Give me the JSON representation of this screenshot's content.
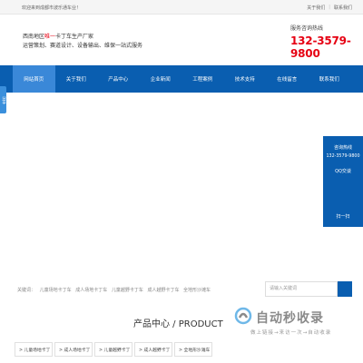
{
  "topbar": {
    "welcome": "欢迎来到成都市波乐通车业！",
    "links": [
      "关于我们",
      "联系我们"
    ],
    "separator": "|"
  },
  "header": {
    "slogan_line1_prefix": "西南地区",
    "slogan_line1_highlight": "唯一",
    "slogan_line1_suffix": "卡丁车生产厂家",
    "slogan_line2": "运营策划、赛道设计、设备输出、维保一站式服务",
    "hotline_label": "服务咨询热线",
    "hotline_number": "132-3579-9800"
  },
  "nav": {
    "items": [
      "网站首页",
      "关于我们",
      "产品中心",
      "企业新闻",
      "工程案例",
      "技术支持",
      "在线留言",
      "联系我们"
    ],
    "active_index": 0
  },
  "side_tab": {
    "label": "分享"
  },
  "float_panel": {
    "title": "咨询热线",
    "phone": "132-3579-9800",
    "qq": "QQ交谈",
    "scan": "扫一扫"
  },
  "search": {
    "keywords_label": "关键词：",
    "keywords": [
      "儿童场地卡丁车",
      "成人场地卡丁车",
      "儿童越野卡丁车",
      "成人越野卡丁车",
      "全地形沙滩车"
    ],
    "placeholder": "请输入关键词"
  },
  "products": {
    "title": "产品中心 / PRODUCT",
    "categories": [
      "> 儿童场地卡丁",
      "> 成人场地卡丁",
      "> 儿童越野卡丁",
      "> 成人越野卡丁",
      "> 全地形沙滩车"
    ]
  },
  "watermark": {
    "text": "自动秒收录",
    "sub": "做上链接→来访一次→自动收录"
  },
  "colors": {
    "brand_blue": "#0a5eb0",
    "hotline_red": "#e60012"
  }
}
